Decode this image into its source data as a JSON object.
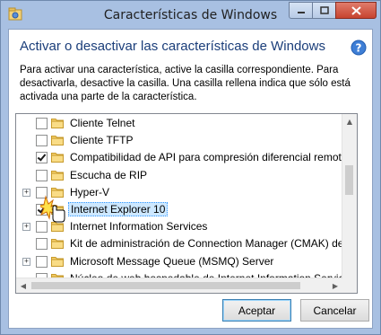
{
  "window": {
    "title": "Características de Windows",
    "controls": {
      "minimize": "minimize",
      "maximize": "maximize",
      "close": "close"
    }
  },
  "heading": "Activar o desactivar las características de Windows",
  "description": "Para activar una característica, active la casilla correspondiente. Para desactivarla, desactive la casilla. Una casilla rellena indica que sólo está activada una parte de la característica.",
  "features": [
    {
      "label": "Cliente Telnet",
      "checked": false,
      "expandable": false,
      "selected": false
    },
    {
      "label": "Cliente TFTP",
      "checked": false,
      "expandable": false,
      "selected": false
    },
    {
      "label": "Compatibilidad de API para compresión diferencial remota",
      "checked": true,
      "expandable": false,
      "selected": false
    },
    {
      "label": "Escucha de RIP",
      "checked": false,
      "expandable": false,
      "selected": false
    },
    {
      "label": "Hyper-V",
      "checked": false,
      "expandable": true,
      "selected": false
    },
    {
      "label": "Internet Explorer 10",
      "checked": true,
      "expandable": false,
      "selected": true
    },
    {
      "label": "Internet Information Services",
      "checked": false,
      "expandable": true,
      "selected": false
    },
    {
      "label": "Kit de administración de Connection Manager (CMAK) de RAS",
      "checked": false,
      "expandable": false,
      "selected": false
    },
    {
      "label": "Microsoft Message Queue (MSMQ) Server",
      "checked": false,
      "expandable": true,
      "selected": false
    },
    {
      "label": "Núcleo de web hospedable de Internet Information Services",
      "checked": false,
      "expandable": false,
      "selected": false
    }
  ],
  "buttons": {
    "ok": "Aceptar",
    "cancel": "Cancelar"
  },
  "colors": {
    "heading": "#1b3e7a",
    "selection": "#cde8ff",
    "frame": "#a8c0e2"
  }
}
